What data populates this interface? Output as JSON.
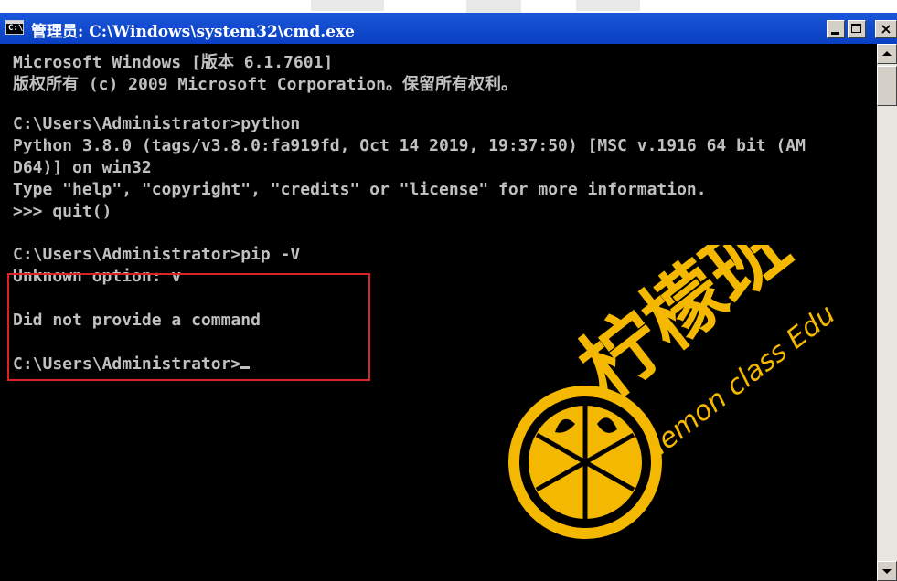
{
  "window": {
    "title": "管理员: C:\\Windows\\system32\\cmd.exe",
    "icon": "cmd-icon",
    "controls": {
      "minimize": "minimize-icon",
      "maximize": "maximize-icon",
      "close": "×"
    }
  },
  "console": {
    "lines": [
      "Microsoft Windows [版本 6.1.7601]",
      "版权所有 (c) 2009 Microsoft Corporation。保留所有权利。",
      "",
      "C:\\Users\\Administrator>python",
      "Python 3.8.0 (tags/v3.8.0:fa919fd, Oct 14 2019, 19:37:50) [MSC v.1916 64 bit (AM",
      "D64)] on win32",
      "Type \"help\", \"copyright\", \"credits\" or \"license\" for more information.",
      ">>> quit()",
      "",
      "C:\\Users\\Administrator>pip -V",
      "Unknown option: v",
      "",
      "Did not provide a command",
      "",
      "C:\\Users\\Administrator>"
    ]
  },
  "watermark": {
    "brand_cn": "柠檬班",
    "brand_en": "lemon class Edu"
  },
  "colors": {
    "titlebar": "#0a3fc2",
    "console_bg": "#000000",
    "console_text": "#c0c0c0",
    "highlight": "#dd2222",
    "logo": "#f5b800"
  }
}
